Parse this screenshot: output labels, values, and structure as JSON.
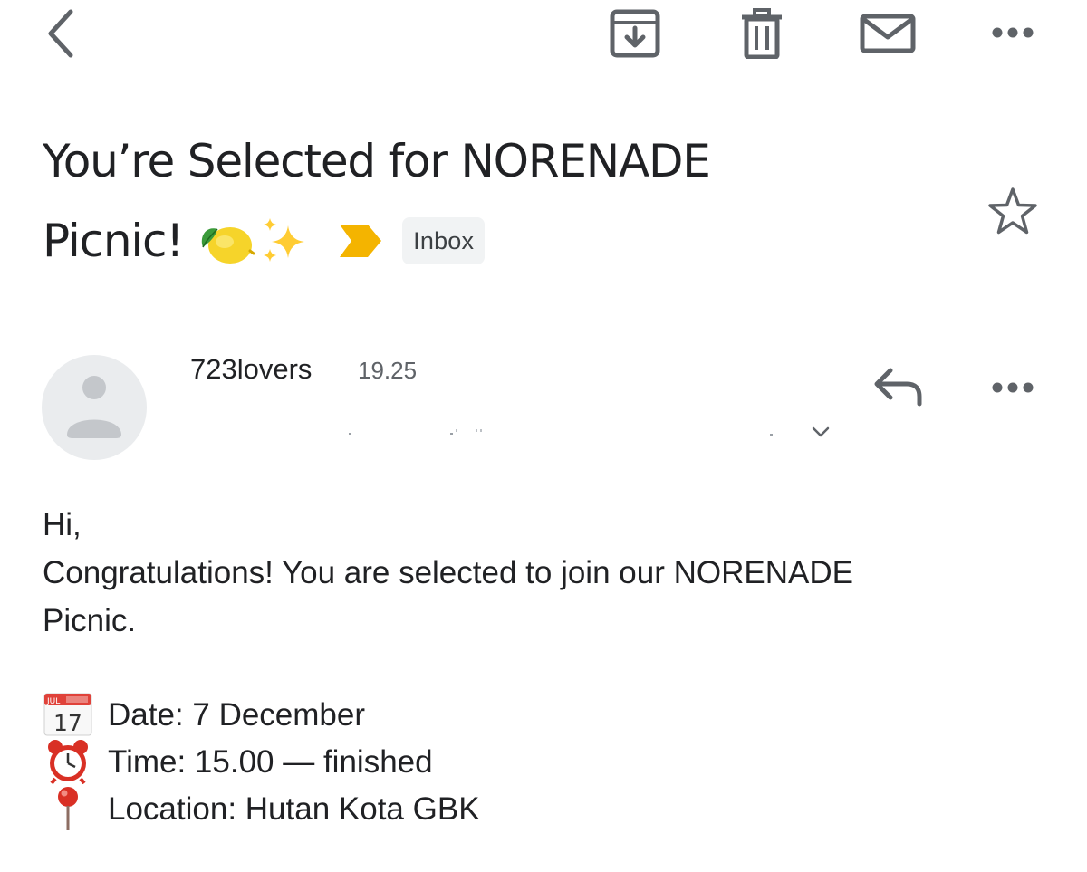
{
  "toolbar": {
    "back_icon": "chevron-left-icon",
    "archive_icon": "archive-icon",
    "delete_icon": "trash-icon",
    "mark_unread_icon": "envelope-icon",
    "more_icon": "more-horizontal-icon"
  },
  "email": {
    "subject_line1": "You’re Selected for NORENADE",
    "subject_line2": "Picnic!",
    "subject_emojis": [
      "🍋",
      "✨"
    ],
    "importance_color": "#f4b400",
    "label_chip": "Inbox",
    "star_icon": "star-outline-icon"
  },
  "message": {
    "sender": "723lovers",
    "time": "19.25",
    "avatar_icon": "person-icon",
    "reply_icon": "reply-icon",
    "more_icon": "more-horizontal-icon",
    "expand_icon": "chevron-down-icon"
  },
  "body": {
    "greeting": "Hi,",
    "line1": "Congratulations! You are selected to join our NORENADE",
    "line2": "Picnic.",
    "details": [
      {
        "emoji": "📅",
        "text": "Date: 7 December"
      },
      {
        "emoji": "⏰",
        "text": "Time: 15.00 — finished"
      },
      {
        "emoji": "📍",
        "text": "Location: Hutan Kota GBK"
      }
    ],
    "calendar_month": "JUL",
    "calendar_day": "17"
  },
  "colors": {
    "icon_gray": "#5f6368",
    "text": "#202124",
    "chip_bg": "#f1f3f4",
    "avatar_bg": "#eaecee"
  }
}
